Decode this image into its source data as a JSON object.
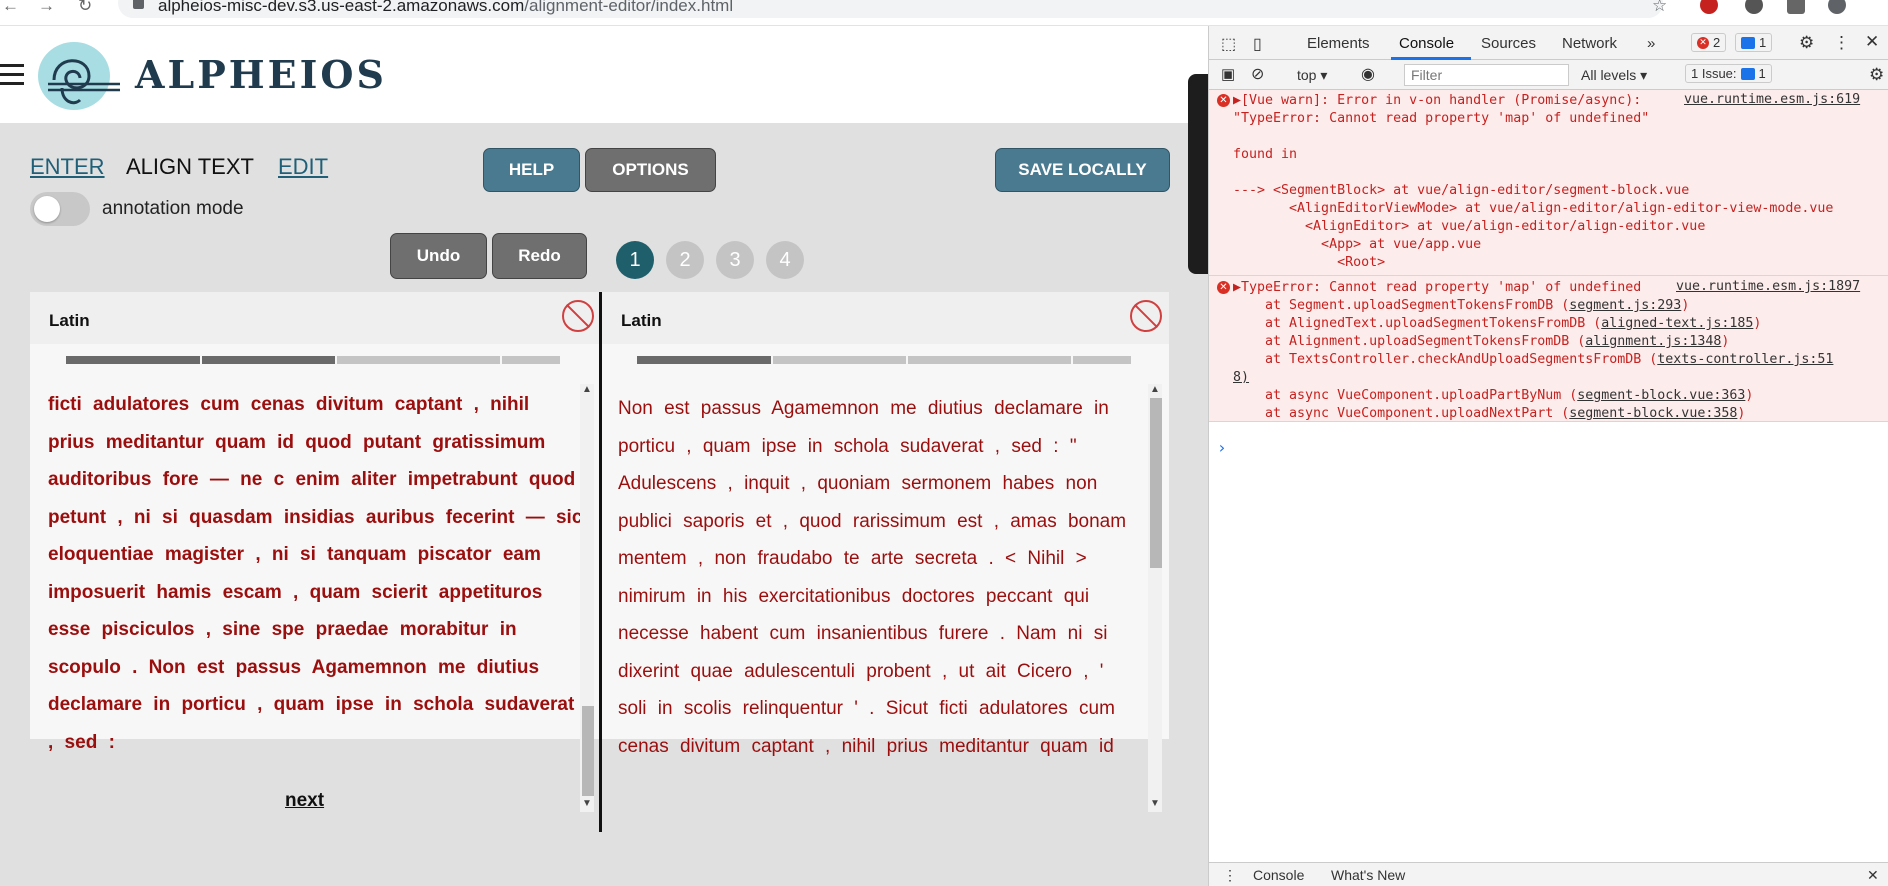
{
  "browser": {
    "url_host": "alpheios-misc-dev.s3.us-east-2.amazonaws.com",
    "url_path": "/alignment-editor/index.html"
  },
  "app": {
    "brand": "ALPHEIOS",
    "modes": {
      "enter": "ENTER",
      "align": "ALIGN TEXT",
      "edit": "EDIT"
    },
    "buttons": {
      "help": "HELP",
      "options": "OPTIONS",
      "save": "SAVE LOCALLY",
      "undo": "Undo",
      "redo": "Redo"
    },
    "annotation_label": "annotation mode",
    "pages": [
      "1",
      "2",
      "3",
      "4"
    ],
    "left_panel": {
      "title": "Latin",
      "text": "ficti adulatores cum cenas divitum captant , nihil prius meditantur quam id quod putant gratissimum auditoribus fore — ne c enim aliter impetrabunt quod petunt , ni si quasdam insidias auribus fecerint — sic eloquentiae magister , ni si tanquam piscator eam imposuerit hamis escam , quam scierit appetituros esse pisciculos , sine spe praedae morabitur in scopulo . Non est passus Agamemnon me diutius declamare in porticu , quam ipse in schola sudaverat , sed :",
      "next": "next"
    },
    "right_panel": {
      "title": "Latin",
      "text": "Non est passus Agamemnon me diutius declamare in porticu , quam ipse in schola sudaverat , sed : \" Adulescens , inquit , quoniam sermonem habes non publici saporis et , quod rarissimum est , amas bonam mentem , non fraudabo te arte secreta . < Nihil > nimirum in his exercitationibus doctores peccant qui necesse habent cum insanientibus furere . Nam ni si dixerint quae adulescentuli probent , ut ait Cicero , ' soli in scolis relinquentur ' . Sicut ficti adulatores cum cenas divitum captant , nihil prius meditantur quam id quod putant gratissimum"
    }
  },
  "devtools": {
    "tabs": [
      "Elements",
      "Console",
      "Sources",
      "Network"
    ],
    "more": "»",
    "error_count": "2",
    "message_count": "1",
    "context": "top",
    "filter_placeholder": "Filter",
    "levels": "All levels",
    "issues": "1 Issue:",
    "issues_count": "1",
    "error1": {
      "line1": "▶[Vue warn]: Error in v-on handler (Promise/async):",
      "source": "vue.runtime.esm.js:619",
      "line2": "\"TypeError: Cannot read property 'map' of undefined\"",
      "line3": "found in",
      "line4": "---> <SegmentBlock> at vue/align-editor/segment-block.vue",
      "line5": "       <AlignEditorViewMode> at vue/align-editor/align-editor-view-mode.vue",
      "line6": "         <AlignEditor> at vue/align-editor/align-editor.vue",
      "line7": "           <App> at vue/app.vue",
      "line8": "             <Root>"
    },
    "error2": {
      "line1": "▶TypeError: Cannot read property 'map' of undefined",
      "source": "vue.runtime.esm.js:1897",
      "stack": [
        {
          "text": "    at Segment.uploadSegmentTokensFromDB (",
          "link": "segment.js:293",
          "end": ")"
        },
        {
          "text": "    at AlignedText.uploadSegmentTokensFromDB (",
          "link": "aligned-text.js:185",
          "end": ")"
        },
        {
          "text": "    at Alignment.uploadSegmentTokensFromDB (",
          "link": "alignment.js:1348",
          "end": ")"
        },
        {
          "text": "    at TextsController.checkAndUploadSegmentsFromDB (",
          "link": "texts-controller.js:51",
          "end": ""
        }
      ],
      "wrap": "8)",
      "async1": {
        "text": "    at async VueComponent.uploadPartByNum (",
        "link": "segment-block.vue:363",
        "end": ")"
      },
      "async2": {
        "text": "    at async VueComponent.uploadNextPart (",
        "link": "segment-block.vue:358",
        "end": ")"
      }
    },
    "prompt": "›",
    "bottom_tabs": [
      "Console",
      "What's New"
    ],
    "bottom_close": "✕"
  }
}
